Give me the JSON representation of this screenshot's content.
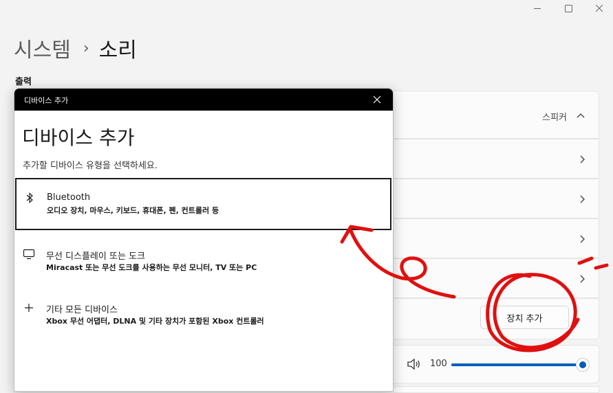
{
  "window": {
    "minimize_glyph": "",
    "maximize_glyph": ""
  },
  "breadcrumb": {
    "parent": "시스템",
    "separator": "›",
    "current": "소리"
  },
  "section": {
    "output_title": "출력"
  },
  "settings": {
    "speaker_label": "스피커",
    "add_device_button": "장치 추가",
    "volume_value": "100",
    "volume_level": 1.0
  },
  "dialog": {
    "titlebar": "디바이스 추가",
    "heading": "디바이스 추가",
    "subtitle": "추가할 디바이스 유형을 선택하세요.",
    "options": [
      {
        "title": "Bluetooth",
        "description": "오디오 장치, 마우스, 키보드, 휴대폰, 펜, 컨트롤러 등",
        "icon": "bluetooth-icon"
      },
      {
        "title": "무선 디스플레이 또는 도크",
        "description": "Miracast 또는 무선 도크를 사용하는 무선 모니터, TV 또는 PC",
        "icon": "monitor-icon"
      },
      {
        "title": "기타 모든 디바이스",
        "description": "Xbox 무선 어댑터, DLNA 및 기타 장치가 포함된 Xbox 컨트롤러",
        "icon": "plus-icon"
      }
    ]
  },
  "colors": {
    "accent": "#005fb8",
    "annotation": "#e01010",
    "titlebar": "#000000"
  }
}
